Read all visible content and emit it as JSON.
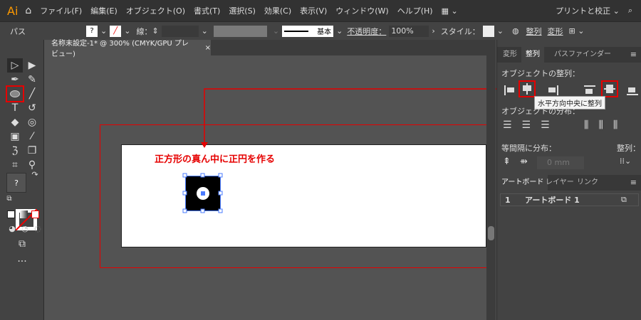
{
  "app": {
    "logo": "Ai",
    "menus": [
      "ファイル(F)",
      "編集(E)",
      "オブジェクト(O)",
      "書式(T)",
      "選択(S)",
      "効果(C)",
      "表示(V)",
      "ウィンドウ(W)",
      "ヘルプ(H)"
    ],
    "workspace": "プリントと校正"
  },
  "control": {
    "object_type": "パス",
    "stroke_label": "線：",
    "stroke_style": "基本",
    "opacity_label": "不透明度：",
    "opacity_value": "100%",
    "style_label": "スタイル：",
    "align_link": "整列",
    "transform_link": "変形"
  },
  "document": {
    "tab_title": "名称未設定-1* @ 300% (CMYK/GPU プレビュー)",
    "close": "×"
  },
  "annotation": {
    "text": "正方形の真ん中に正円を作る",
    "color": "#e60000"
  },
  "panel": {
    "tabs": [
      "変形",
      "整列",
      "パスファインダー"
    ],
    "active_tab": "整列",
    "align_objects_label": "オブジェクトの整列：",
    "tooltip": "水平方向中央に整列",
    "distribute_objects_label": "オブジェクトの分布：",
    "distribute_spacing_label": "等間隔に分布：",
    "spacing_value": "0 mm",
    "align_to_label": "整列：",
    "bottom_tabs": [
      "アートボード",
      "レイヤー",
      "リンク"
    ],
    "artboards": [
      {
        "index": "1",
        "name": "アートボード 1"
      }
    ]
  },
  "toolbar": {
    "fill_unknown": "?"
  }
}
